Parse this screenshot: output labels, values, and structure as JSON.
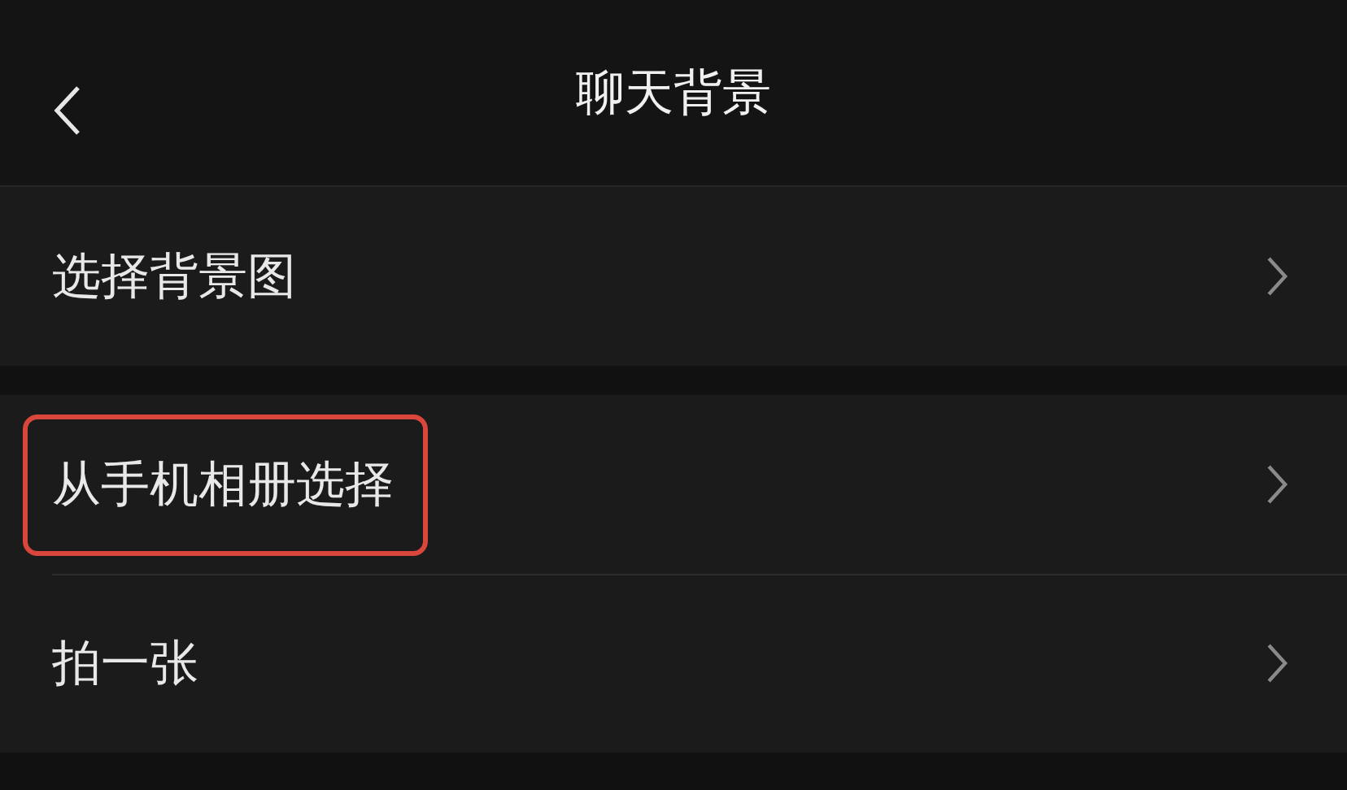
{
  "header": {
    "title": "聊天背景"
  },
  "sections": [
    {
      "items": [
        {
          "label": "选择背景图",
          "highlighted": false
        }
      ]
    },
    {
      "items": [
        {
          "label": "从手机相册选择",
          "highlighted": true
        },
        {
          "label": "拍一张",
          "highlighted": false
        }
      ]
    }
  ]
}
